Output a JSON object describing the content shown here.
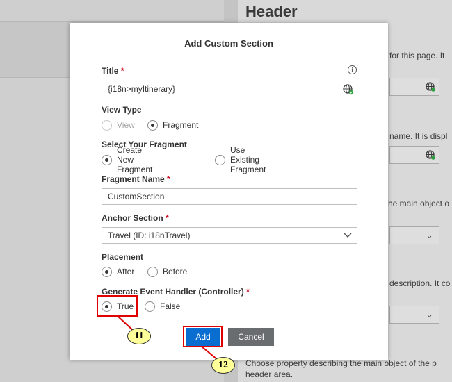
{
  "background": {
    "header": "Header",
    "texts": [
      "for this page. It",
      "name. It is displ",
      "he main object o",
      "description. It co",
      "Choose property describing the main object of the p",
      "header area."
    ]
  },
  "dialog": {
    "title": "Add Custom Section",
    "title_field": {
      "label": "Title",
      "required_mark": "*",
      "value": "{i18n>myItinerary}",
      "info_icon": "i"
    },
    "view_type": {
      "label": "View Type",
      "options": [
        "View",
        "Fragment"
      ],
      "selected": "Fragment",
      "disabled_options": [
        "View"
      ]
    },
    "select_fragment": {
      "label": "Select Your Fragment",
      "options": [
        "Create New Fragment",
        "Use Existing Fragment"
      ],
      "selected": "Create New Fragment"
    },
    "fragment_name": {
      "label": "Fragment Name",
      "required_mark": "*",
      "value": "CustomSection"
    },
    "anchor_section": {
      "label": "Anchor Section",
      "required_mark": "*",
      "value": "Travel (ID: i18nTravel)"
    },
    "placement": {
      "label": "Placement",
      "options": [
        "After",
        "Before"
      ],
      "selected": "After"
    },
    "event_handler": {
      "label": "Generate Event Handler (Controller)",
      "required_mark": "*",
      "options": [
        "True",
        "False"
      ],
      "selected": "True"
    },
    "buttons": {
      "add": "Add",
      "cancel": "Cancel"
    }
  },
  "callouts": [
    "11",
    "12"
  ],
  "colors": {
    "accent": "#0a6ed1",
    "required": "#d0021b",
    "highlight": "#e00000",
    "callout_fill": "#ffff99"
  }
}
